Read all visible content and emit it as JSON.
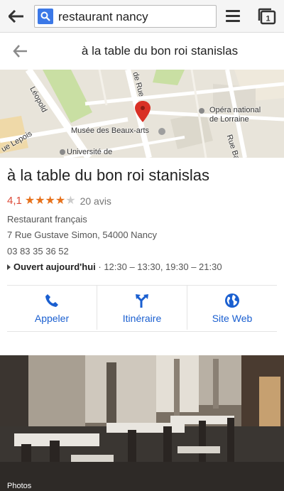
{
  "search": {
    "query": "restaurant nancy"
  },
  "header": {
    "title": "à la table du bon roi stanislas"
  },
  "map": {
    "labels": [
      "Léopold",
      "de Rue",
      "Opéra national",
      "de Lorraine",
      "Musée des Beaux-arts",
      "ue Lepois",
      "Université de",
      "Rue Bail"
    ]
  },
  "place": {
    "name": "à la table du bon roi stanislas",
    "rating": "4,1",
    "stars_filled": 4,
    "stars_total": 5,
    "reviews": "20 avis",
    "category": "Restaurant français",
    "address": "7 Rue Gustave Simon, 54000 Nancy",
    "phone": "03 83 35 36 52",
    "hours_status": "Ouvert aujourd'hui",
    "hours_detail": " · 12:30 – 13:30, 19:30 – 21:30"
  },
  "actions": [
    {
      "label": "Appeler",
      "icon": "phone-icon"
    },
    {
      "label": "Itinéraire",
      "icon": "directions-icon"
    },
    {
      "label": "Site Web",
      "icon": "globe-icon"
    }
  ],
  "photo": {
    "label": "Photos"
  },
  "colors": {
    "accent_blue": "#1a5fd0",
    "rating_orange": "#e7711b",
    "rating_value": "#dd4b39",
    "pin_red": "#d93025"
  }
}
